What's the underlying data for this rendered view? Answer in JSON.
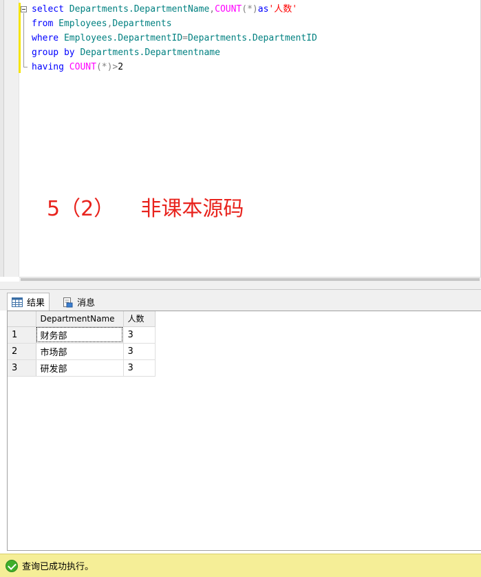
{
  "editor": {
    "lines": [
      [
        {
          "t": "select ",
          "c": "kw"
        },
        {
          "t": "Departments.DepartmentName",
          "c": "id"
        },
        {
          "t": ",",
          "c": "op"
        },
        {
          "t": "COUNT",
          "c": "fn"
        },
        {
          "t": "(*)",
          "c": "op"
        },
        {
          "t": "as",
          "c": "kw"
        },
        {
          "t": "'人数'",
          "c": "str"
        }
      ],
      [
        {
          "t": "from ",
          "c": "kw"
        },
        {
          "t": "Employees",
          "c": "id"
        },
        {
          "t": ",",
          "c": "op"
        },
        {
          "t": "Departments",
          "c": "id"
        }
      ],
      [
        {
          "t": "where ",
          "c": "kw"
        },
        {
          "t": "Employees.DepartmentID",
          "c": "id"
        },
        {
          "t": "=",
          "c": "op"
        },
        {
          "t": "Departments.DepartmentID",
          "c": "id"
        }
      ],
      [
        {
          "t": "group by ",
          "c": "kw"
        },
        {
          "t": "Departments.Departmentname",
          "c": "id"
        }
      ],
      [
        {
          "t": "having ",
          "c": "kw"
        },
        {
          "t": "COUNT",
          "c": "fn"
        },
        {
          "t": "(*)>",
          "c": "op"
        },
        {
          "t": "2",
          "c": "num"
        }
      ]
    ],
    "annotation": "5（2）    非课本源码"
  },
  "tabs": {
    "results_label": "结果",
    "messages_label": "消息"
  },
  "results": {
    "columns": [
      "DepartmentName",
      "人数"
    ],
    "rows": [
      {
        "num": "1",
        "cells": [
          "财务部",
          "3"
        ]
      },
      {
        "num": "2",
        "cells": [
          "市场部",
          "3"
        ]
      },
      {
        "num": "3",
        "cells": [
          "研发部",
          "3"
        ]
      }
    ]
  },
  "status": {
    "text": "查询已成功执行。"
  },
  "colors": {
    "keyword": "#0000ff",
    "function": "#ff00ff",
    "identifier": "#008080",
    "string": "#ff0000",
    "annotation": "#e8231d",
    "status_bg": "#f5ee97"
  },
  "icons": {
    "results_tab": "grid-icon",
    "messages_tab": "message-icon",
    "status": "success-check-icon"
  }
}
